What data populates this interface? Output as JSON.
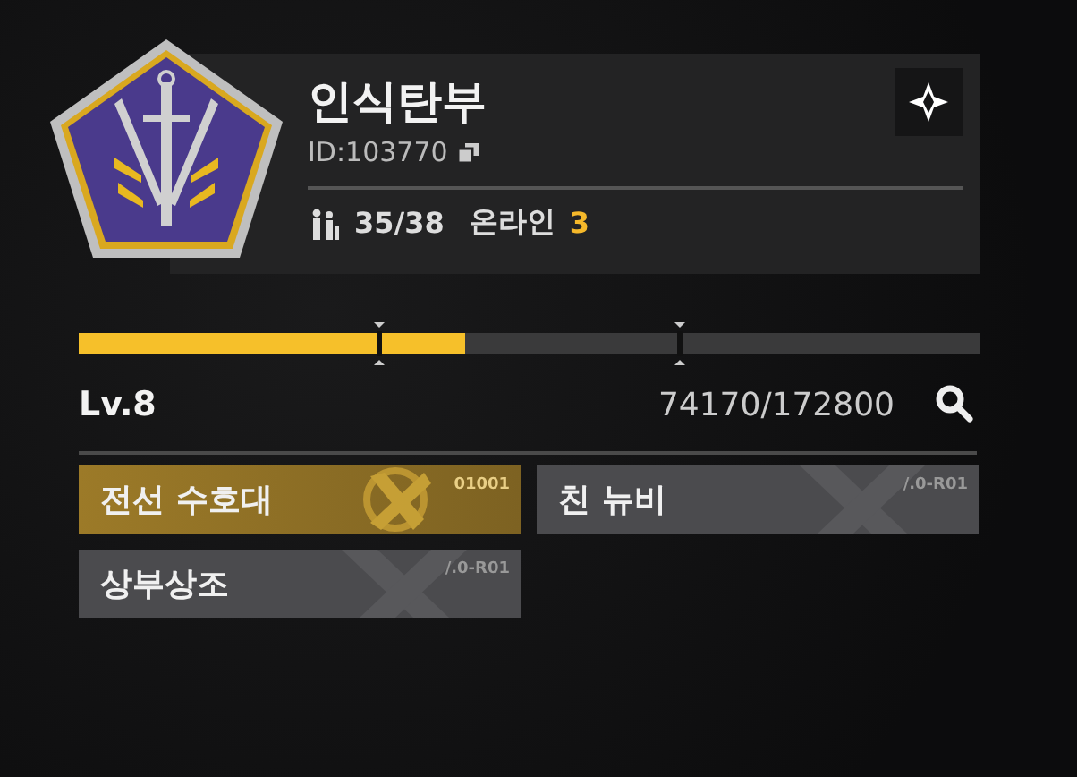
{
  "guild": {
    "name": "인식탄부",
    "id": "ID:103770",
    "members": "35/38",
    "online_label": "온라인",
    "online_count": "3"
  },
  "progress": {
    "level": 0.429,
    "level_label": "Lv.8",
    "exp": "74170/172800"
  },
  "tags": [
    {
      "label": "전선 수호대",
      "code": "01001",
      "highlighted": true
    },
    {
      "label": "친 뉴비",
      "code": "/.0-R01",
      "highlighted": false
    },
    {
      "label": "상부상조",
      "code": "/.0-R01",
      "highlighted": false
    }
  ]
}
